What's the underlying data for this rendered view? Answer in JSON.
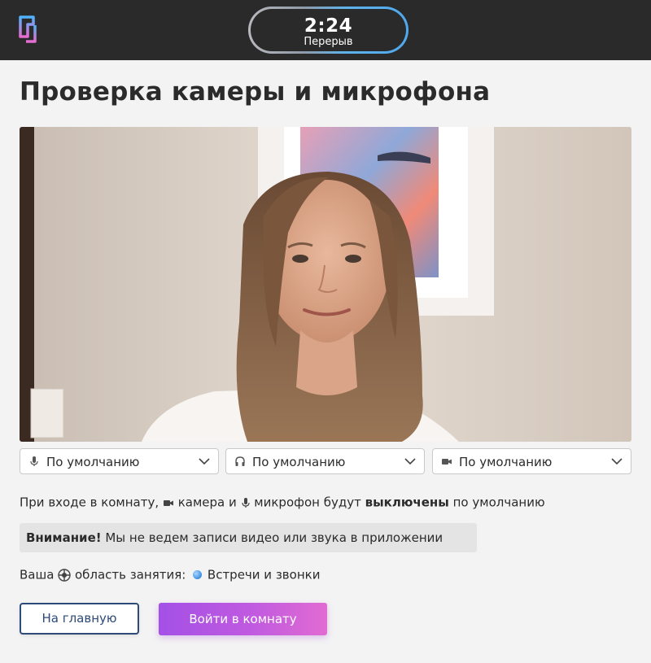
{
  "header": {
    "logo_icon": "app-logo-icon",
    "timer": {
      "time": "2:24",
      "label": "Перерыв"
    }
  },
  "page": {
    "title": "Проверка камеры и микрофона"
  },
  "devices": {
    "microphone": {
      "icon": "microphone-icon",
      "value": "По умолчанию"
    },
    "speaker": {
      "icon": "headphones-icon",
      "value": "По умолчанию"
    },
    "camera": {
      "icon": "camera-icon",
      "value": "По умолчанию"
    }
  },
  "notice": {
    "part1": "При входе в комнату,",
    "camera_word": "камера",
    "and_word": "и",
    "mic_word": "микрофон",
    "will_be": "будут",
    "off_word": "выключены",
    "default_word": "по умолчанию"
  },
  "warning": {
    "strong": "Внимание!",
    "text": "Мы не ведем записи видео или звука в приложении"
  },
  "activity": {
    "prefix": "Ваша",
    "label": "область занятия:",
    "value": "Встречи и звонки"
  },
  "buttons": {
    "home": "На главную",
    "enter": "Войти в комнату"
  },
  "colors": {
    "header_bg": "#2a2a2b",
    "accent_blue": "#2d4a78",
    "enter_gradient_start": "#a450e6",
    "enter_gradient_end": "#e16bd2"
  }
}
